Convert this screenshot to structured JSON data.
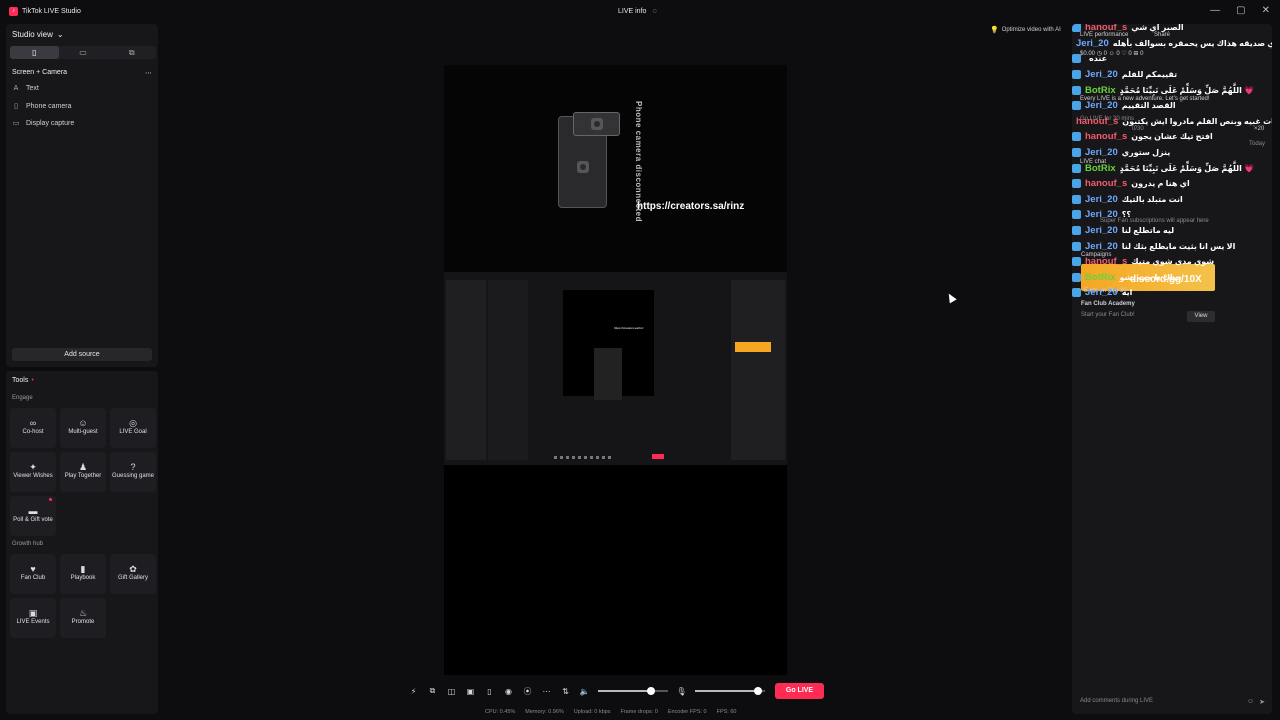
{
  "app": {
    "title": "TikTok LIVE Studio",
    "logo_glyph": "♪",
    "center_title": "LIVE info",
    "center_icon": "◌",
    "win_controls": [
      "—",
      "▢",
      "✕"
    ]
  },
  "studio": {
    "view_label": "Studio view",
    "view_chevron": "⌄",
    "view_tabs": [
      "▯",
      "▭",
      "⧉"
    ],
    "scene_label": "Screen + Camera",
    "scene_more": "⋯",
    "sources": [
      {
        "icon": "A",
        "label": "Text"
      },
      {
        "icon": "▯",
        "label": "Phone camera"
      },
      {
        "icon": "▭",
        "label": "Display capture"
      }
    ],
    "add_source": "Add source"
  },
  "tools": {
    "title": "Tools",
    "title_dot": "•",
    "engage_label": "Engage",
    "growth_label": "Growth hub",
    "engage_items": [
      {
        "icon": "∞",
        "label": "Co-host"
      },
      {
        "icon": "☺",
        "label": "Multi-guest"
      },
      {
        "icon": "◎",
        "label": "LIVE Goal"
      },
      {
        "icon": "✦",
        "label": "Viewer Wishes"
      },
      {
        "icon": "♟",
        "label": "Play Together"
      },
      {
        "icon": "?",
        "label": "Guessing game"
      },
      {
        "icon": "▬",
        "label": "Poll & Gift vote"
      }
    ],
    "growth_items": [
      {
        "icon": "♥",
        "label": "Fan Club"
      },
      {
        "icon": "▮",
        "label": "Playbook"
      },
      {
        "icon": "✿",
        "label": "Gift Gallery"
      },
      {
        "icon": "▣",
        "label": "LIVE Events"
      },
      {
        "icon": "♨",
        "label": "Promote"
      }
    ]
  },
  "preview": {
    "disconnected_text": "Phone camera disconnected",
    "url_text": "https://creators.sa/rinz",
    "nested_url": "https://creators.sa/rinz"
  },
  "controls": {
    "icons": [
      "⚡",
      "⧉",
      "◫",
      "▣",
      "▯",
      "◉",
      "⦿",
      "⋯",
      "⇅",
      "🔈"
    ],
    "mic_icon": "🎙",
    "speaker_level": 0.75,
    "mic_level": 0.9,
    "go_live": "Go LIVE"
  },
  "stats": [
    "CPU: 0.45%",
    "Memory: 0.96%",
    "Upload: 0 kbps",
    "Frame drops: 0",
    "Encoder FPS: 0",
    "FPS: 60"
  ],
  "right": {
    "optimize_ai": "Optimize video with AI",
    "bulb": "💡",
    "live_performance": "LIVE performance",
    "share": "Share",
    "perf_stats": "$0.00  ◷ 0  ☺ 0  ♡ 0  ⊞ 0",
    "new_adventure": "Every LIVE is a new adventure. Let's get started!",
    "go_live_for": "Go LIVE for 30 mins",
    "progress": "0/30",
    "x20": "×20",
    "today": "Today",
    "live_chat": "LIVE chat",
    "super_fan": "Super Fan subscriptions will appear here",
    "campaigns": "Campaigns",
    "ends_on": "Ends on Sep 30",
    "promo_url": "discord.gg/10X",
    "fan_club_academy": "Fan Club Academy",
    "fan_club_sub": "Start your Fan Club!",
    "view_btn": "View",
    "comment_placeholder": "Add comments during LIVE",
    "comment_icons": [
      "☺",
      "➤"
    ]
  },
  "chat": [
    {
      "user": "BotRix",
      "color": "green",
      "text": "اللَّهُمَّ صَلِّ وَسَلِّمْ عَلَى نَبِيِّنَا مُحَمَّدٍ 💗"
    },
    {
      "user": "hanouf_s",
      "color": "red",
      "text": "الصبر اي شي"
    },
    {
      "user": "Jeri_20",
      "color": "blue",
      "text": "عائله زي صديقه هذاك يس يحمقره بسوالف بأهله"
    },
    {
      "user": "",
      "color": "blue",
      "text": "عنده"
    },
    {
      "user": "Jeri_20",
      "color": "blue",
      "text": "تقييمكم للفلم"
    },
    {
      "user": "BotRix",
      "color": "green",
      "text": "اللَّهُمَّ صَلِّ وَسَلِّمْ عَلَى نَبِيِّنَا مُحَمَّدٍ 💗"
    },
    {
      "user": "Jeri_20",
      "color": "blue",
      "text": "القصد التقييم"
    },
    {
      "user": "hanouf_s",
      "color": "red",
      "text": "في لقطات غبيه وبنص الفلم مادروا ايش يكتبون"
    },
    {
      "user": "hanouf_s",
      "color": "red",
      "text": "افتح تيك عشان يجون"
    },
    {
      "user": "Jeri_20",
      "color": "blue",
      "text": "ينزل ستوري"
    },
    {
      "user": "BotRix",
      "color": "green",
      "text": "اللَّهُمَّ صَلِّ وَسَلِّمْ عَلَى نَبِيِّنَا مُحَمَّدٍ 💗"
    },
    {
      "user": "hanouf_s",
      "color": "red",
      "text": "اي هنا م يدرون"
    },
    {
      "user": "Jeri_20",
      "color": "blue",
      "text": "انت متبلد بالتيك"
    },
    {
      "user": "Jeri_20",
      "color": "blue",
      "text": "؟؟"
    },
    {
      "user": "Jeri_20",
      "color": "blue",
      "text": "ليه ماتطلع لنا"
    },
    {
      "user": "Jeri_20",
      "color": "blue",
      "text": "الا يس انا بثيت مايطلع بثك لنا"
    },
    {
      "user": "hanouf_s",
      "color": "red",
      "text": "شوي مدي شوي متيك"
    },
    {
      "user": "BotRix",
      "color": "green",
      "text": "حياك يا حب بشو"
    },
    {
      "user": "Jeri_20",
      "color": "blue",
      "text": "ايه"
    }
  ]
}
